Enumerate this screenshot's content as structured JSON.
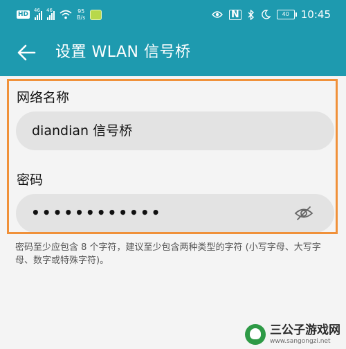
{
  "status_bar": {
    "hd_badge": "HD",
    "sim1_label": "46",
    "sim2_label": "46",
    "net_speed_value": "95",
    "net_speed_unit": "B/s",
    "nfc_label": "N",
    "battery_level": "40",
    "time": "10:45"
  },
  "app_bar": {
    "title": "设置 WLAN 信号桥",
    "background_color": "#1e9aaf"
  },
  "form": {
    "name_label": "网络名称",
    "name_value": "diandian 信号桥",
    "password_label": "密码",
    "password_masked": "••••••••••••",
    "password_toggle_icon": "eye-off-icon"
  },
  "hint_text": "密码至少应包含 8 个字符，建议至少包含两种类型的字符 (小写字母、大写字母、数字或特殊字符)。",
  "highlight_color": "#f0913a",
  "watermark": {
    "name": "三公子游戏网",
    "url": "www.sangongzi.net"
  }
}
